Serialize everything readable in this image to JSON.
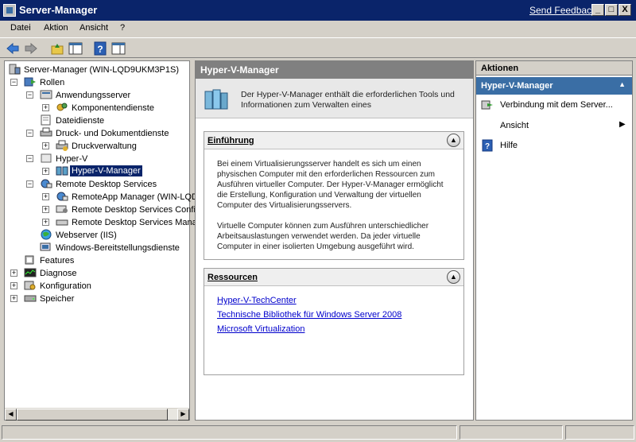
{
  "window": {
    "title": "Server-Manager",
    "send_feedback": "Send Feedback",
    "min": "_",
    "max": "□",
    "close": "X"
  },
  "menu": [
    "Datei",
    "Aktion",
    "Ansicht",
    "?"
  ],
  "tree": {
    "root": "Server-Manager (WIN-LQD9UKM3P1S)",
    "rollen": "Rollen",
    "anwendungsserver": "Anwendungsserver",
    "komponentendienste": "Komponentendienste",
    "dateidienste": "Dateidienste",
    "druck": "Druck- und Dokumentdienste",
    "druckverwaltung": "Druckverwaltung",
    "hyperv": "Hyper-V",
    "hypervmanager": "Hyper-V-Manager",
    "rds": "Remote Desktop Services",
    "remoteapp": "RemoteApp Manager (WIN-LQD",
    "rdsconfig": "Remote Desktop Services Confi",
    "rdsmana": "Remote Desktop Services Mana",
    "webserver": "Webserver (IIS)",
    "wds": "Windows-Bereitstellungsdienste",
    "features": "Features",
    "diagnose": "Diagnose",
    "konfiguration": "Konfiguration",
    "speicher": "Speicher"
  },
  "center": {
    "header": "Hyper-V-Manager",
    "intro": "Der Hyper-V-Manager enthält die erforderlichen Tools und Informationen zum Verwalten eines",
    "einfuehrung": {
      "title": "Einführung",
      "p1": "Bei einem Virtualisierungsserver handelt es sich um einen physischen Computer mit den erforderlichen Ressourcen zum Ausführen virtueller Computer. Der Hyper-V-Manager ermöglicht die Erstellung, Konfiguration und Verwaltung der virtuellen Computer des Virtualisierungsservers.",
      "p2": "Virtuelle Computer können zum Ausführen unterschiedlicher Arbeitsauslastungen verwendet werden. Da jeder virtuelle Computer in einer isolierten Umgebung ausgeführt wird."
    },
    "ressourcen": {
      "title": "Ressourcen",
      "links": [
        "Hyper-V-TechCenter",
        "Technische Bibliothek für Windows Server 2008",
        "Microsoft Virtualization"
      ]
    }
  },
  "actions": {
    "title": "Aktionen",
    "section": "Hyper-V-Manager",
    "items": [
      "Verbindung mit dem Server...",
      "Ansicht",
      "Hilfe"
    ]
  }
}
